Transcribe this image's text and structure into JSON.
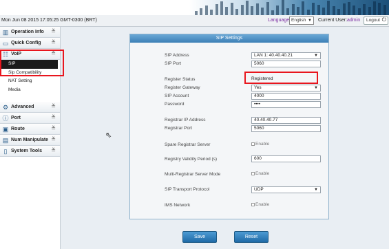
{
  "header": {
    "datetime": "Mon Jun 08 2015 17:05:25 GMT-0300 (BRT)",
    "language_label": "Language",
    "language_value": "English",
    "current_user_label": "Current User:",
    "current_user": "admin",
    "logout_label": "Logout"
  },
  "sidebar": {
    "operation_info": "Operation Info",
    "quick_config": "Quick Config",
    "voip": "VoIP",
    "voip_items": [
      "SIP",
      "Sip Compatibility",
      "NAT Setting",
      "Media"
    ],
    "advanced": "Advanced",
    "port": "Port",
    "route": "Route",
    "num_manipulate": "Num Manipulate",
    "system_tools": "System Tools"
  },
  "panel": {
    "title": "SIP Settings",
    "sip_address_label": "SIP Address",
    "sip_address_value": "LAN 1: 40.40.40.21",
    "sip_port_label": "SIP Port",
    "sip_port_value": "5060",
    "register_status_label": "Register Status",
    "register_status_value": "Registered",
    "register_gateway_label": "Register Gateway",
    "register_gateway_value": "Yes",
    "sip_account_label": "SIP Account",
    "sip_account_value": "4000",
    "password_label": "Password",
    "password_value": "••••",
    "registrar_ip_label": "Registrar IP Address",
    "registrar_ip_value": "40.40.40.77",
    "registrar_port_label": "Registrar Port",
    "registrar_port_value": "5060",
    "spare_registrar_label": "Spare Registrar Server",
    "spare_registrar_enable": "Enable",
    "validity_label": "Registry Validity Period (s)",
    "validity_value": "600",
    "multi_registrar_label": "Multi-Registrar Server Mode",
    "multi_registrar_enable": "Enable",
    "transport_label": "SIP Transport Protocol",
    "transport_value": "UDP",
    "ims_label": "IMS Network",
    "ims_enable": "Enable"
  },
  "buttons": {
    "save": "Save",
    "reset": "Reset"
  },
  "colors": {
    "highlight": "#e8161e",
    "panel_title": "#3c7fb6",
    "button": "#1f6aa6"
  }
}
